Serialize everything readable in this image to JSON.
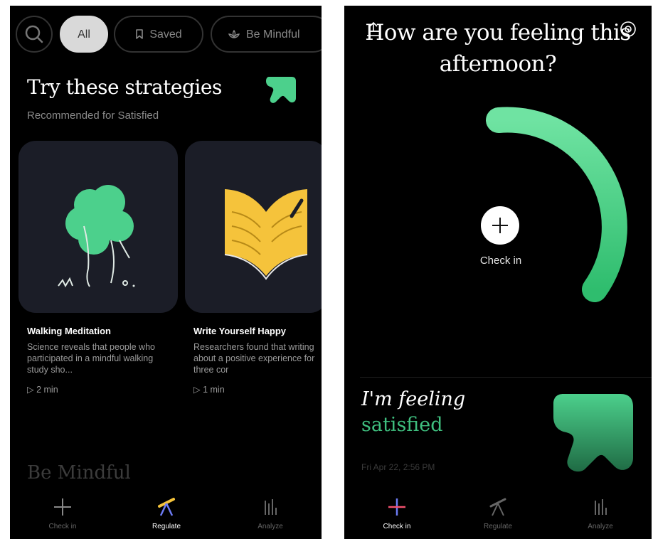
{
  "left": {
    "chips": {
      "all": "All",
      "saved": "Saved",
      "be_mindful": "Be Mindful"
    },
    "strategies": {
      "title": "Try these strategies",
      "subtitle": "Recommended for Satisfied"
    },
    "cards": [
      {
        "title": "Walking Meditation",
        "desc": "Science reveals that people who participated in a mindful walking study sho...",
        "duration": "2 min"
      },
      {
        "title": "Write Yourself Happy",
        "desc": "Researchers found that writing about a positive experience for three cor",
        "duration": "1 min"
      }
    ],
    "section2_title": "Be Mindful"
  },
  "right": {
    "question": "How are you feeling this afternoon?",
    "checkin_label": "Check in",
    "feeling_prefix": "I'm feeling",
    "feeling_value": "satisfied",
    "timestamp": "Fri Apr 22, 2:56 PM"
  },
  "tabs": {
    "checkin": "Check in",
    "regulate": "Regulate",
    "analyze": "Analyze"
  },
  "colors": {
    "accent_green": "#3fbf7f",
    "card_bg": "#1b1d27",
    "book_yellow": "#f5c33b"
  }
}
